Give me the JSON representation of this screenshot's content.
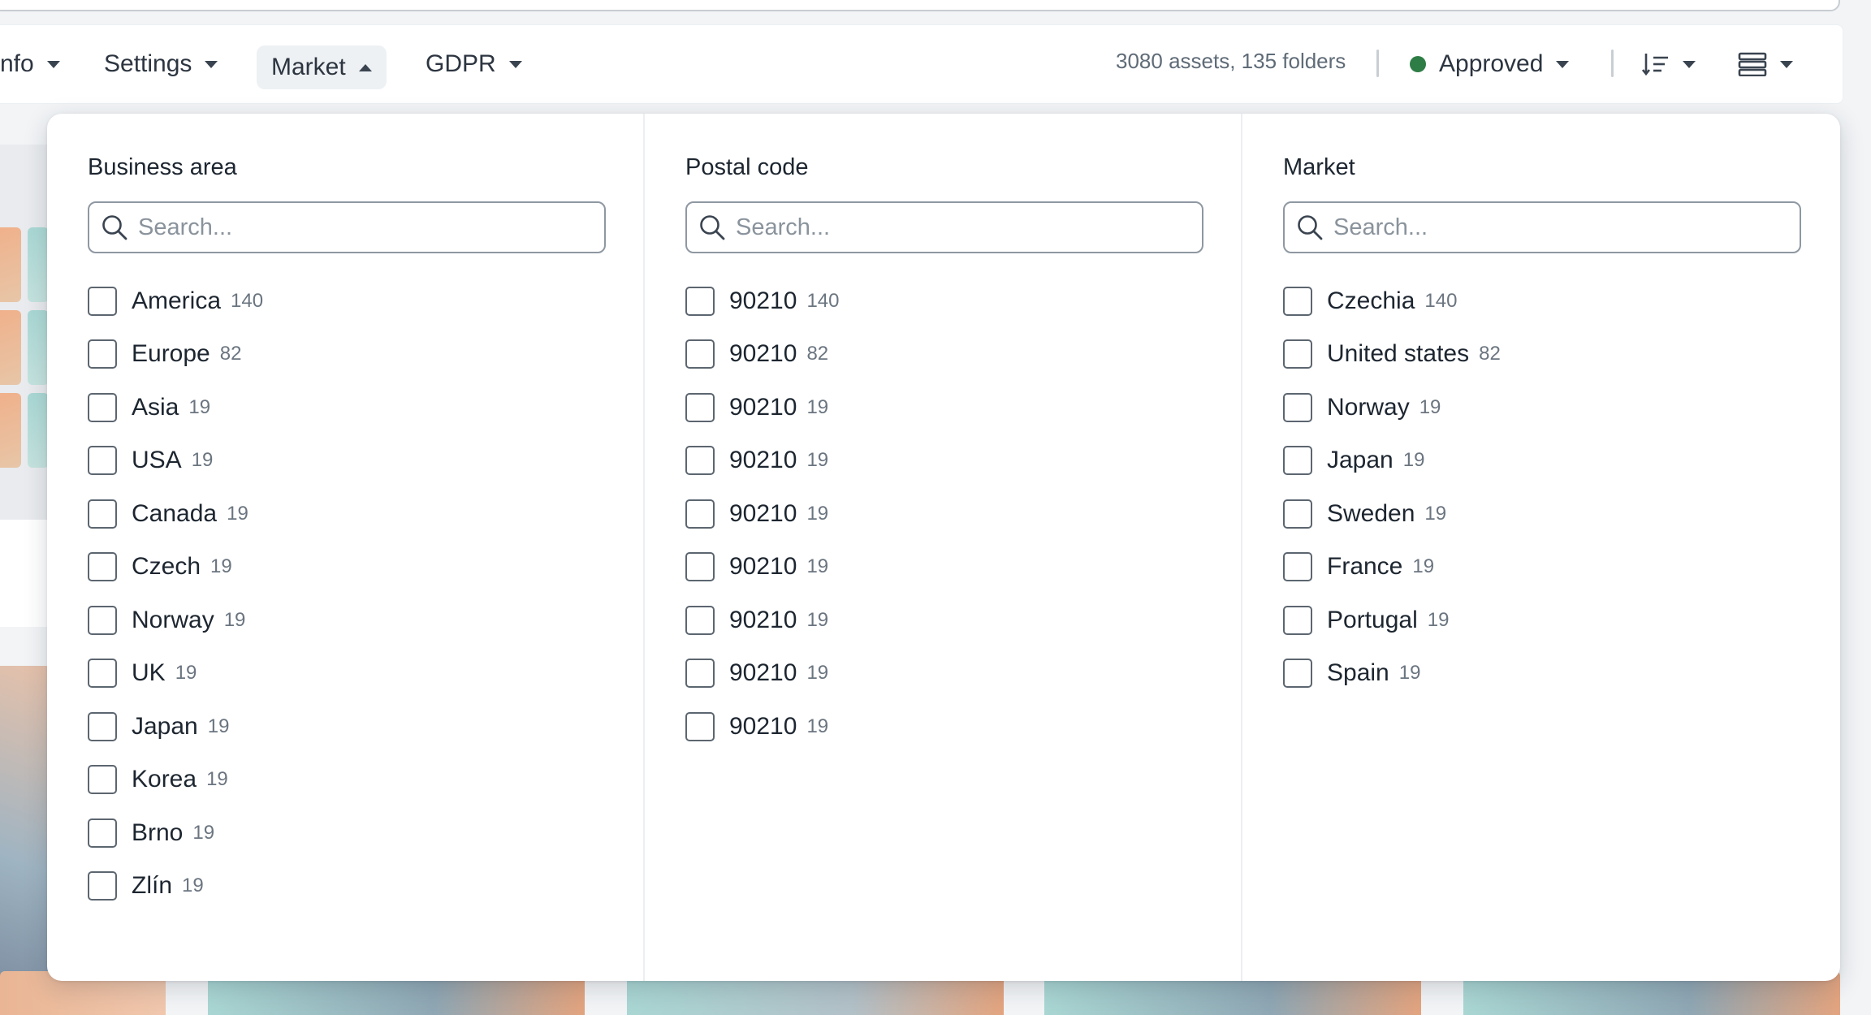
{
  "toolbar": {
    "items": [
      {
        "label": "nfo"
      },
      {
        "label": "Settings"
      },
      {
        "label": "Market"
      },
      {
        "label": "GDPR"
      }
    ],
    "asset_count": "3080 assets, 135 folders",
    "status_filter": {
      "label": "Approved",
      "color": "#2e7d46"
    },
    "sort_icon": "sort-lines-icon",
    "view_icon": "list-view-icon"
  },
  "dropdown": {
    "columns": [
      {
        "title": "Business area",
        "search_placeholder": "Search...",
        "options": [
          {
            "label": "America",
            "count": "140"
          },
          {
            "label": "Europe",
            "count": "82"
          },
          {
            "label": "Asia",
            "count": "19"
          },
          {
            "label": "USA",
            "count": "19"
          },
          {
            "label": "Canada",
            "count": "19"
          },
          {
            "label": "Czech",
            "count": "19"
          },
          {
            "label": "Norway",
            "count": "19"
          },
          {
            "label": "UK",
            "count": "19"
          },
          {
            "label": "Japan",
            "count": "19"
          },
          {
            "label": "Korea",
            "count": "19"
          },
          {
            "label": "Brno",
            "count": "19"
          },
          {
            "label": "Zlín",
            "count": "19"
          }
        ]
      },
      {
        "title": "Postal code",
        "search_placeholder": "Search...",
        "options": [
          {
            "label": "90210",
            "count": "140"
          },
          {
            "label": "90210",
            "count": "82"
          },
          {
            "label": "90210",
            "count": "19"
          },
          {
            "label": "90210",
            "count": "19"
          },
          {
            "label": "90210",
            "count": "19"
          },
          {
            "label": "90210",
            "count": "19"
          },
          {
            "label": "90210",
            "count": "19"
          },
          {
            "label": "90210",
            "count": "19"
          },
          {
            "label": "90210",
            "count": "19"
          }
        ]
      },
      {
        "title": "Market",
        "search_placeholder": "Search...",
        "options": [
          {
            "label": "Czechia",
            "count": "140"
          },
          {
            "label": "United states",
            "count": "82"
          },
          {
            "label": "Norway",
            "count": "19"
          },
          {
            "label": "Japan",
            "count": "19"
          },
          {
            "label": "Sweden",
            "count": "19"
          },
          {
            "label": "France",
            "count": "19"
          },
          {
            "label": "Portugal",
            "count": "19"
          },
          {
            "label": "Spain",
            "count": "19"
          }
        ]
      }
    ]
  }
}
